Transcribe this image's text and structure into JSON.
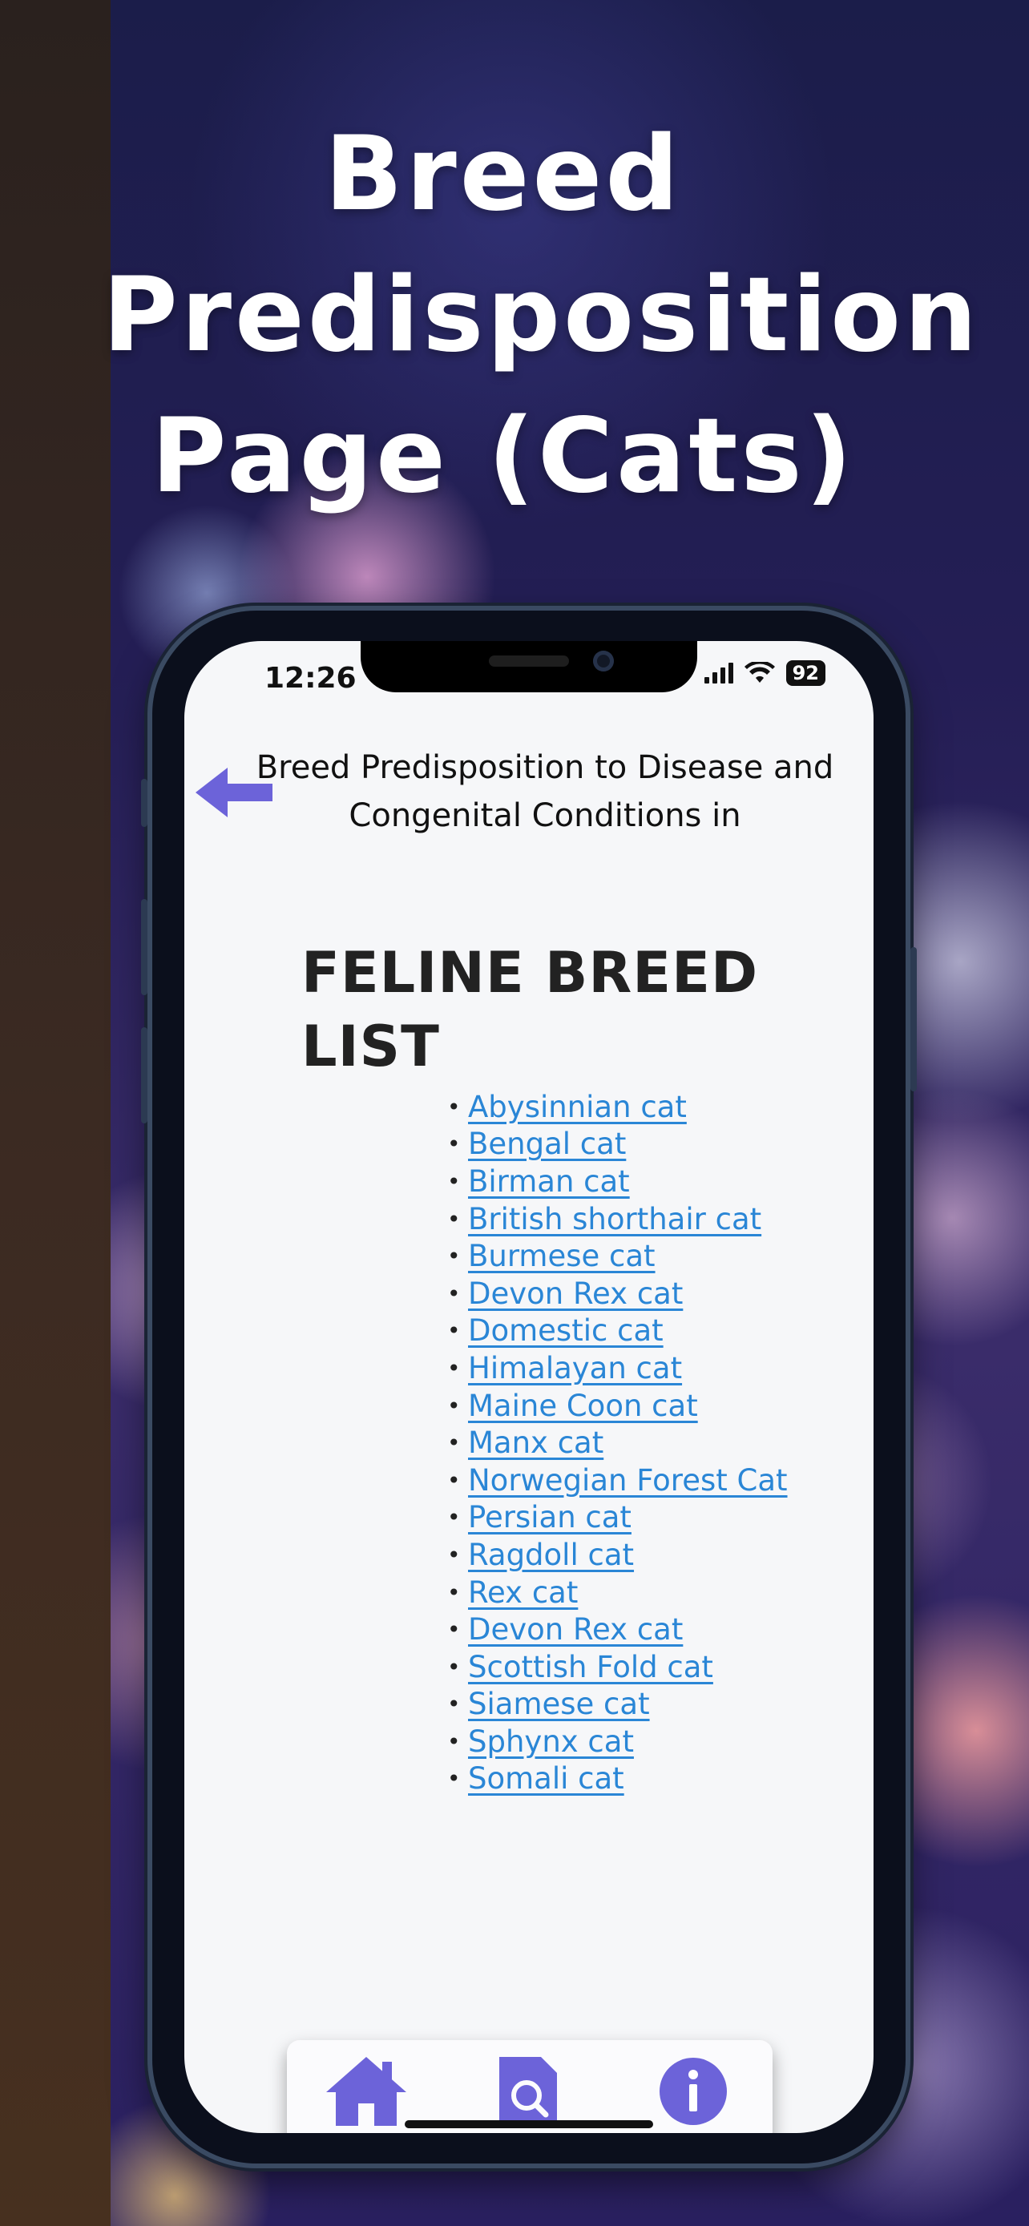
{
  "headline": "Breed Predisposition Page (Cats)",
  "status_bar": {
    "time": "12:26",
    "battery": "92"
  },
  "page": {
    "subtitle": "Breed Predisposition to Disease and Congenital Conditions in",
    "title": "FELINE BREED LIST"
  },
  "breeds": [
    "Abysinnian cat",
    "Bengal cat",
    "Birman cat",
    "British shorthair cat",
    "Burmese cat",
    "Devon Rex cat",
    "Domestic cat",
    "Himalayan cat",
    "Maine Coon cat",
    "Manx cat",
    "Norwegian Forest Cat",
    "Persian cat",
    "Ragdoll cat",
    "Rex cat",
    "Devon Rex cat",
    "Scottish Fold cat",
    "Siamese cat",
    "Sphynx cat",
    "Somali cat"
  ],
  "tabbar": {
    "tabs": [
      {
        "icon": "home-icon",
        "active": false
      },
      {
        "icon": "search-document-icon",
        "active": false
      },
      {
        "icon": "info-icon",
        "active": true
      }
    ]
  },
  "colors": {
    "accent": "#6c63d9",
    "link": "#2a86d6",
    "text": "#222222"
  }
}
